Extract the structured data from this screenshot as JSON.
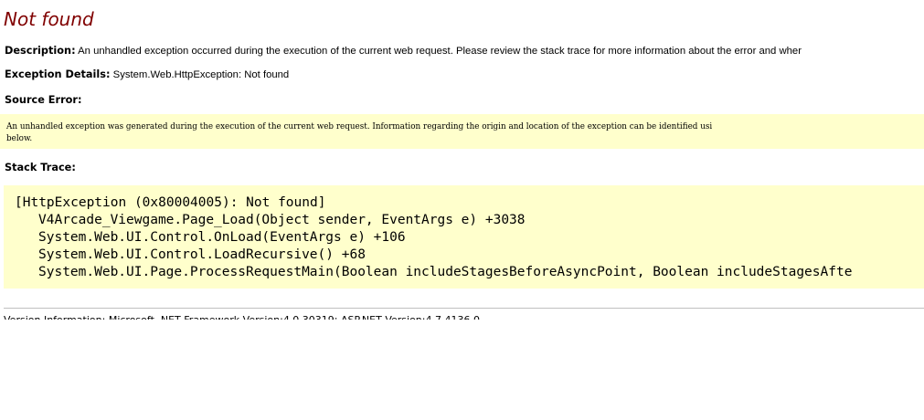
{
  "error": {
    "title": "Not found",
    "description_label": "Description:",
    "description_text": "An unhandled exception occurred during the execution of the current web request. Please review the stack trace for more information about the error and wher",
    "exception_label": "Exception Details:",
    "exception_text": "System.Web.HttpException: Not found",
    "source_error_label": "Source Error:",
    "source_error_lines": [
      "An unhandled exception was generated during the execution of the current web request. Information regarding the origin and location of the exception can be identified usi",
      "below."
    ],
    "stack_trace_label": "Stack Trace:",
    "stack_trace": [
      "[HttpException (0x80004005): Not found]",
      "V4Arcade_Viewgame.Page_Load(Object sender, EventArgs e) +3038",
      "System.Web.UI.Control.OnLoad(EventArgs e) +106",
      "System.Web.UI.Control.LoadRecursive() +68",
      "System.Web.UI.Page.ProcessRequestMain(Boolean includeStagesBeforeAsyncPoint, Boolean includeStagesAfte"
    ]
  },
  "colors": {
    "title": "#800000",
    "code_background": "#ffffcc",
    "divider": "#c0c0c0"
  }
}
